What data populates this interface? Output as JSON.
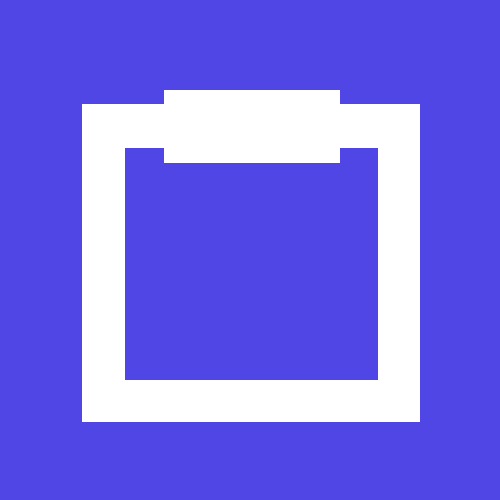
{
  "icon": {
    "name": "clipboard-icon",
    "background_color": "#4f46e5",
    "foreground_color": "#ffffff"
  }
}
